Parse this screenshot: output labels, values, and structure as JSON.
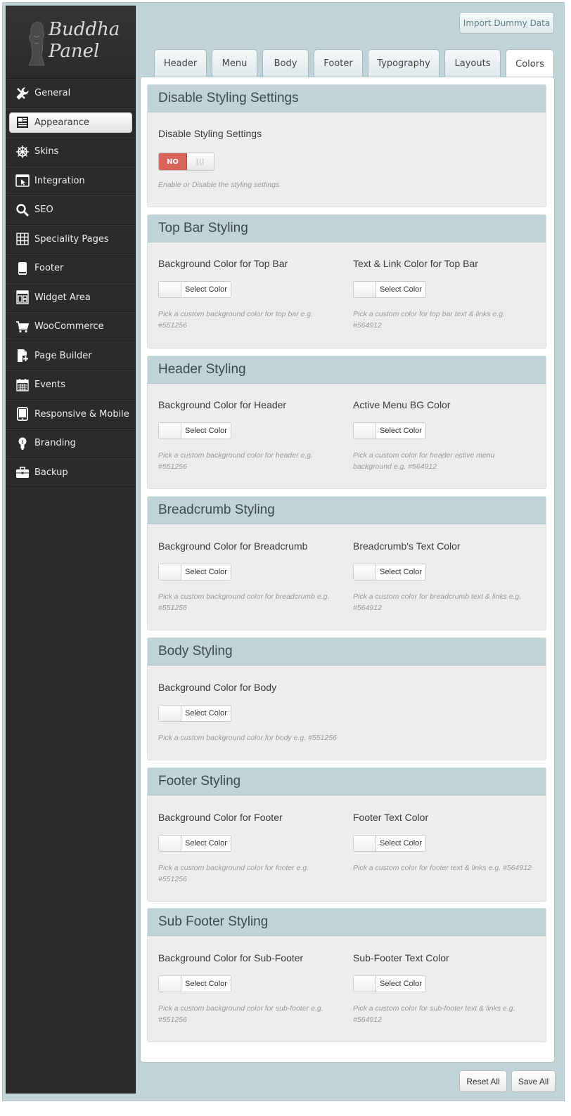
{
  "brand": {
    "line1": "Buddha",
    "line2": "Panel"
  },
  "header": {
    "import_label": "Import Dummy Data"
  },
  "sidebar": {
    "items": [
      {
        "label": "General",
        "icon": "wrench-icon"
      },
      {
        "label": "Appearance",
        "icon": "newspaper-icon"
      },
      {
        "label": "Skins",
        "icon": "ship-wheel-icon"
      },
      {
        "label": "Integration",
        "icon": "browser-cursor-icon"
      },
      {
        "label": "SEO",
        "icon": "magnifier-icon"
      },
      {
        "label": "Speciality Pages",
        "icon": "grid-icon"
      },
      {
        "label": "Footer",
        "icon": "phone-icon"
      },
      {
        "label": "Widget Area",
        "icon": "widget-icon"
      },
      {
        "label": "WooCommerce",
        "icon": "cart-icon"
      },
      {
        "label": "Page Builder",
        "icon": "page-add-icon"
      },
      {
        "label": "Events",
        "icon": "calendar-icon"
      },
      {
        "label": "Responsive & Mobile",
        "icon": "mobile-icon"
      },
      {
        "label": "Branding",
        "icon": "bulb-icon"
      },
      {
        "label": "Backup",
        "icon": "briefcase-icon"
      }
    ]
  },
  "tabs": [
    "Header",
    "Menu",
    "Body",
    "Footer",
    "Typography",
    "Layouts",
    "Colors"
  ],
  "sections": {
    "disable": {
      "title": "Disable Styling Settings",
      "label": "Disable Styling Settings",
      "toggle_off": "NO",
      "toggle_handle": "|||",
      "desc": "Enable or Disable the styling settings"
    },
    "topbar": {
      "title": "Top Bar Styling",
      "left_label": "Background Color for Top Bar",
      "left_desc_1": "Pick a custom background color for top bar e.g.",
      "left_desc_2": "#551256",
      "right_label": "Text & Link Color for Top Bar",
      "right_desc_1": "Pick a custom color for top bar text & links e.g.",
      "right_desc_2": "#564912"
    },
    "header": {
      "title": "Header Styling",
      "left_label": "Background Color for Header",
      "left_desc_1": "Pick a custom background color for header e.g.",
      "left_desc_2": "#551256",
      "right_label": "Active Menu BG Color",
      "right_desc_1": "Pick a custom color for header active menu",
      "right_desc_2": "background e.g. #564912"
    },
    "breadcrumb": {
      "title": "Breadcrumb Styling",
      "left_label": "Background Color for Breadcrumb",
      "left_desc_1": "Pick a custom background color for breadcrumb e.g.",
      "left_desc_2": "#551256",
      "right_label": "Breadcrumb's Text Color",
      "right_desc_1": "Pick a custom color for breadcrumb text & links e.g.",
      "right_desc_2": "#564912"
    },
    "body": {
      "title": "Body Styling",
      "left_label": "Background Color for Body",
      "left_desc_1": "Pick a custom background color for body e.g. #551256"
    },
    "footer": {
      "title": "Footer Styling",
      "left_label": "Background Color for Footer",
      "left_desc_1": "Pick a custom background color for footer e.g.",
      "left_desc_2": "#551256",
      "right_label": "Footer Text Color",
      "right_desc_1": "Pick a custom color for footer text & links e.g. #564912"
    },
    "subfooter": {
      "title": "Sub Footer Styling",
      "left_label": "Background Color for Sub-Footer",
      "left_desc_1": "Pick a custom background color for sub-footer e.g.",
      "left_desc_2": "#551256",
      "right_label": "Sub-Footer Text Color",
      "right_desc_1": "Pick a custom color for sub-footer text & links e.g.",
      "right_desc_2": "#564912"
    }
  },
  "color_button_label": "Select Color",
  "footer_buttons": {
    "reset": "Reset All",
    "save": "Save All"
  },
  "colors": {
    "accent": "#c0d3d9",
    "sidebar": "#2b2b2b",
    "toggle_no": "#d9645a"
  }
}
